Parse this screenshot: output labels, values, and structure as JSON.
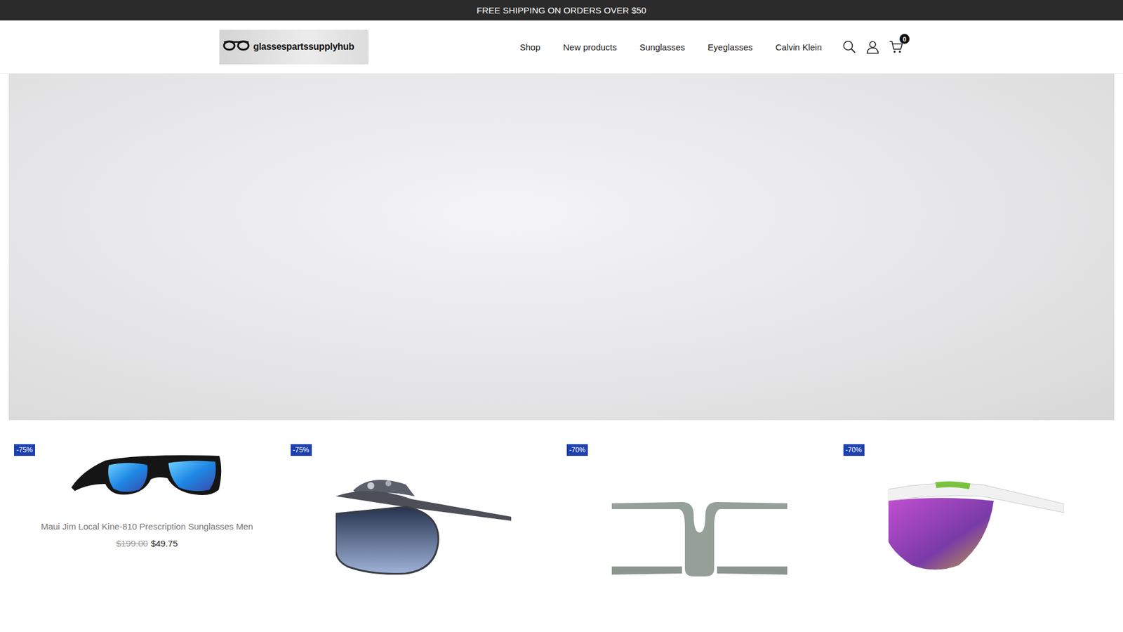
{
  "announcement": "FREE SHIPPING ON ORDERS OVER $50",
  "logo": {
    "text": "glassespartssupplyhub"
  },
  "nav": [
    {
      "label": "Shop"
    },
    {
      "label": "New products"
    },
    {
      "label": "Sunglasses"
    },
    {
      "label": "Eyeglasses"
    },
    {
      "label": "Calvin Klein"
    }
  ],
  "cart": {
    "count": "0"
  },
  "products": [
    {
      "badge": "-75%",
      "kind": "wrap",
      "name": "Maui Jim Local Kine-810 Prescription Sunglasses Men",
      "old_price": "$199.00",
      "price": "$49.75"
    },
    {
      "badge": "-75%",
      "kind": "clubmaster"
    },
    {
      "badge": "-70%",
      "kind": "frame"
    },
    {
      "badge": "-70%",
      "kind": "shield"
    }
  ]
}
